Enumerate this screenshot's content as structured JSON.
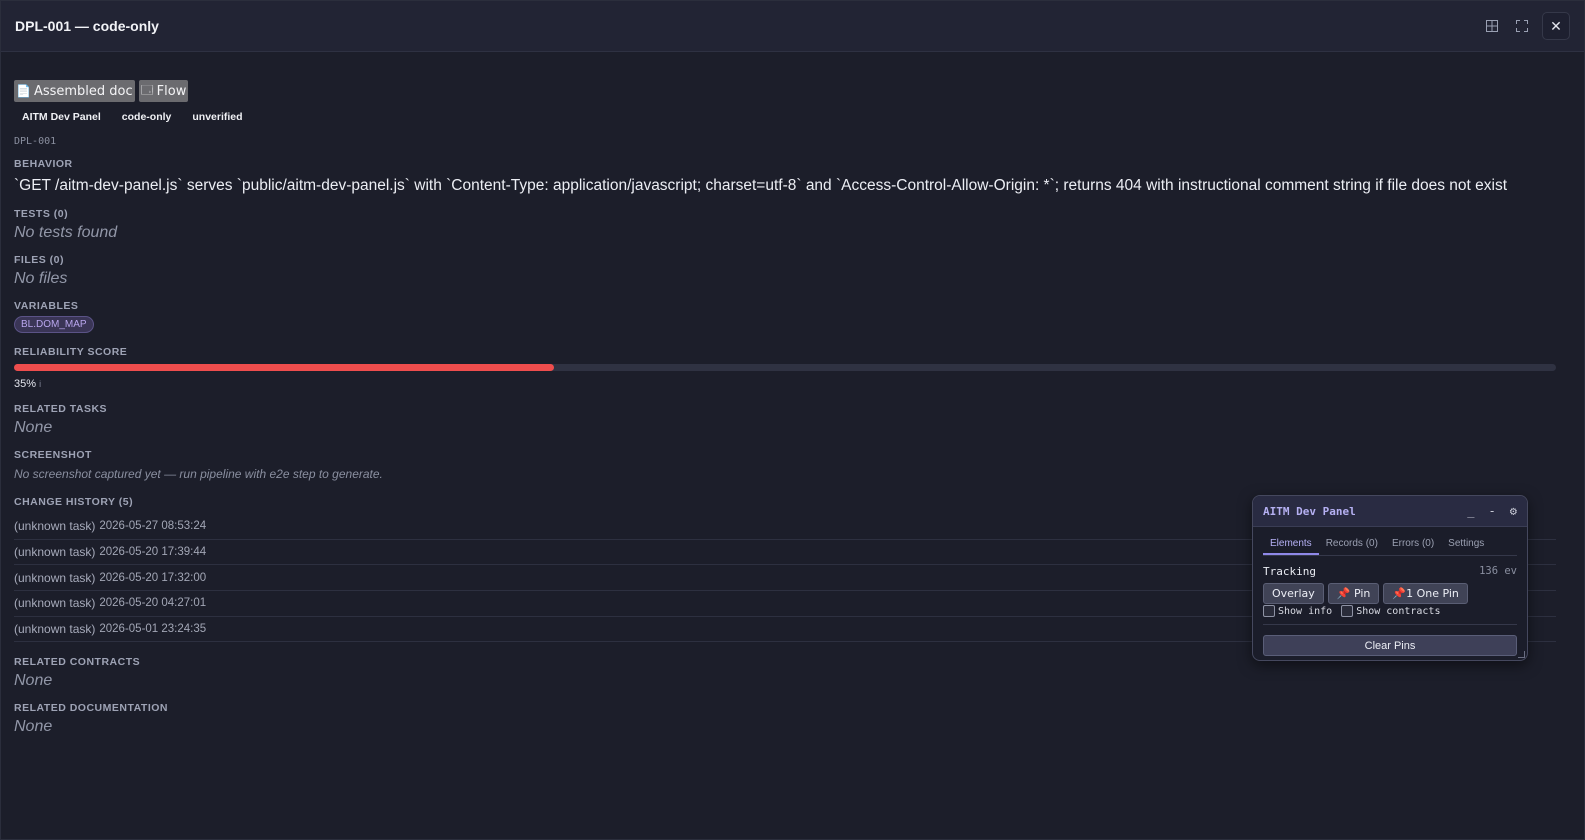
{
  "window": {
    "title": "DPL-001 — code-only",
    "icons": [
      "grid-icon",
      "fullscreen-icon",
      "close-icon"
    ],
    "close_glyph": "✕"
  },
  "toolbar": {
    "assembled_doc_label": "Assembled doc",
    "flow_label": "Flow",
    "assembled_doc_icon": "📄",
    "flow_icon": "🗔"
  },
  "tags": [
    "AITM Dev Panel",
    "code-only",
    "unverified"
  ],
  "id": "DPL-001",
  "sections": {
    "behavior_label": "BEHAVIOR",
    "behavior_text": "`GET /aitm-dev-panel.js` serves `public/aitm-dev-panel.js` with `Content-Type: application/javascript; charset=utf-8` and `Access-Control-Allow-Origin: *`; returns 404 with instructional comment string if file does not exist",
    "tests_label": "TESTS (0)",
    "tests_empty": "No tests found",
    "files_label": "FILES (0)",
    "files_empty": "No files",
    "variables_label": "VARIABLES",
    "variables": [
      "BL.DOM_MAP"
    ],
    "reliability_label": "RELIABILITY SCORE",
    "reliability_value": 35,
    "reliability_text": "35%",
    "reliability_info": "i",
    "reliability_color": "#ee4d4d",
    "related_tasks_label": "RELATED TASKS",
    "related_tasks_empty": "None",
    "screenshot_label": "SCREENSHOT",
    "screenshot_empty": "No screenshot captured yet — run pipeline with e2e step to generate.",
    "history_label": "CHANGE HISTORY (5)",
    "history": [
      {
        "task": "(unknown task)",
        "time": "2026-05-27 08:53:24"
      },
      {
        "task": "(unknown task)",
        "time": "2026-05-20 17:39:44"
      },
      {
        "task": "(unknown task)",
        "time": "2026-05-20 17:32:00"
      },
      {
        "task": "(unknown task)",
        "time": "2026-05-20 04:27:01"
      },
      {
        "task": "(unknown task)",
        "time": "2026-05-01 23:24:35"
      }
    ],
    "related_contracts_label": "RELATED CONTRACTS",
    "related_contracts_empty": "None",
    "related_docs_label": "RELATED DOCUMENTATION",
    "related_docs_empty": "None"
  },
  "dev_panel": {
    "title": "AITM Dev Panel",
    "minimize": "_",
    "collapse": "-",
    "settings_icon": "⚙",
    "tabs": [
      "Elements",
      "Records (0)",
      "Errors (0)",
      "Settings"
    ],
    "active_tab": "Elements",
    "tracking_label": "Tracking",
    "tracking_count": "136 ev",
    "overlay_label": "Overlay",
    "pin_label": "📌 Pin",
    "one_pin_label": "📌1 One Pin",
    "show_info_label": "Show info",
    "show_contracts_label": "Show contracts",
    "clear_pins_label": "Clear Pins"
  }
}
